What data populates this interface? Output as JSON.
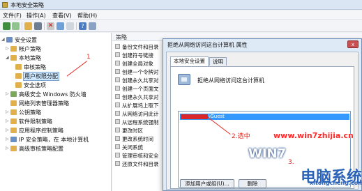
{
  "window": {
    "title": "本地安全策略"
  },
  "menu": [
    "文件(F)",
    "操作(A)",
    "查看(V)",
    "帮助(H)"
  ],
  "tree": [
    {
      "label": "安全设置",
      "level": 0,
      "expanded": true,
      "icon_color": "#6a8ec6"
    },
    {
      "label": "帐户策略",
      "level": 1,
      "expanded": false,
      "icon_color": "#e2b04a"
    },
    {
      "label": "本地策略",
      "level": 1,
      "expanded": true,
      "icon_color": "#e2b04a"
    },
    {
      "label": "审核策略",
      "level": 2,
      "expanded": null,
      "icon_color": "#e2b04a"
    },
    {
      "label": "用户权限分配",
      "level": 2,
      "expanded": null,
      "icon_color": "#e2b04a",
      "selected": true
    },
    {
      "label": "安全选项",
      "level": 2,
      "expanded": null,
      "icon_color": "#e2b04a"
    },
    {
      "label": "高级安全 Windows 防火墙",
      "level": 1,
      "expanded": false,
      "icon_color": "#7aa85a"
    },
    {
      "label": "网络列表管理器策略",
      "level": 1,
      "expanded": null,
      "icon_color": "#e2b04a"
    },
    {
      "label": "公钥策略",
      "level": 1,
      "expanded": false,
      "icon_color": "#e2b04a"
    },
    {
      "label": "软件限制策略",
      "level": 1,
      "expanded": false,
      "icon_color": "#e2b04a"
    },
    {
      "label": "应用程序控制策略",
      "level": 1,
      "expanded": false,
      "icon_color": "#e2b04a"
    },
    {
      "label": "IP 安全策略，在 本地计算机",
      "level": 1,
      "expanded": false,
      "icon_color": "#6a8ec6"
    },
    {
      "label": "高级审核策略配置",
      "level": 1,
      "expanded": false,
      "icon_color": "#e2b04a"
    }
  ],
  "list": {
    "header": "策略",
    "rows": [
      "备份文件和目录",
      "创建符号链接",
      "创建全局对象",
      "创建一个令牌对",
      "创建永久共享对",
      "创建一个页面文",
      "创建永久共享对",
      "从扩展坞上取下",
      "从网络访问此计",
      "从远程系统强制",
      "更改时区",
      "更改系统时间",
      "关闭系统",
      "管理审核和安全",
      "还原文件和目录"
    ]
  },
  "dialog": {
    "title": "拒绝从网络访问这台计算机 属性",
    "close_label": "x",
    "tabs": [
      "本地安全设置",
      "说明"
    ],
    "policy_name": "拒绝从网络访问这台计算机",
    "accounts": [
      {
        "label": "\\Guest",
        "selected": true
      }
    ],
    "add_button": "添加用户或组(U)...",
    "delete_button": "删除"
  },
  "annotations": {
    "step1": "1",
    "step2": "2.选中",
    "step3": "3."
  },
  "watermark": {
    "url": "www.win7zhijia.cn",
    "brand_main": "WIN7",
    "brand_big": "电脑系统城",
    "brand_sub": "xitongcheng.com"
  },
  "colors": {
    "selection_blue": "#3399ff",
    "annotation_red": "#e1251b",
    "dialog_frame": "#dfeaf7"
  }
}
